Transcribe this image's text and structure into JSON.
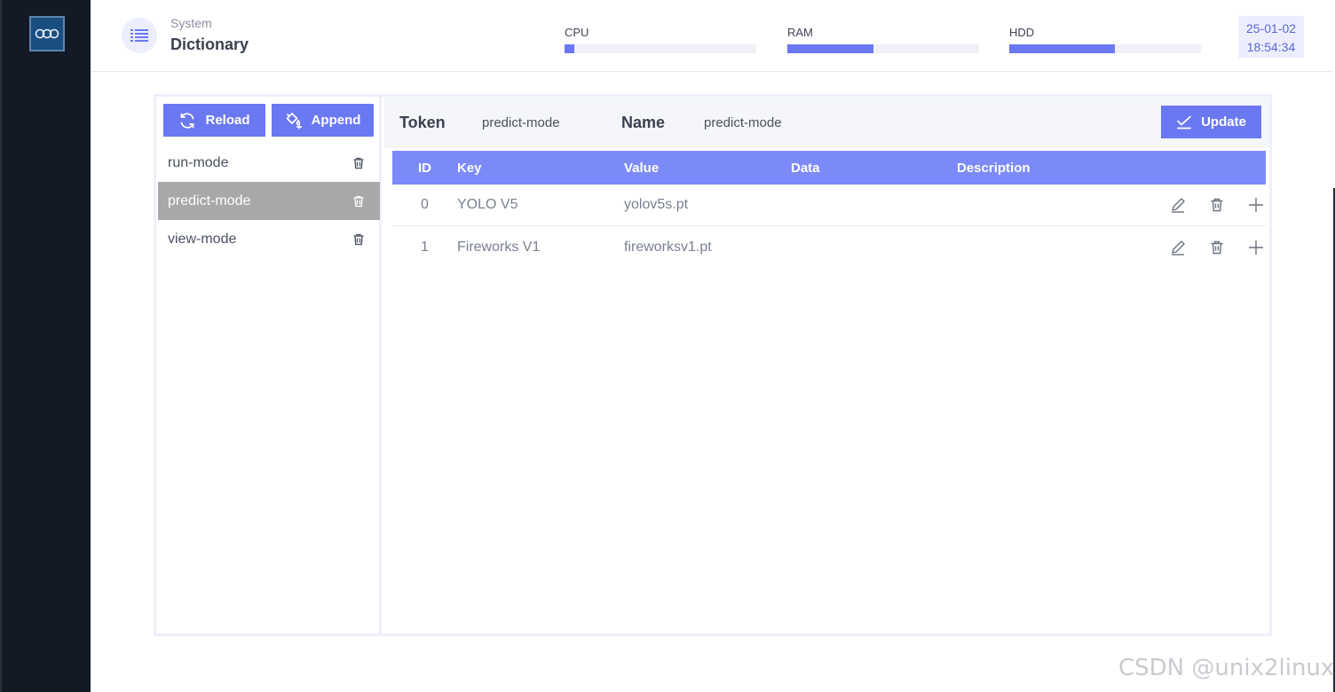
{
  "header": {
    "breadcrumb_parent": "System",
    "title": "Dictionary",
    "meters": [
      {
        "label": "CPU",
        "percent": 5
      },
      {
        "label": "RAM",
        "percent": 45
      },
      {
        "label": "HDD",
        "percent": 55
      }
    ],
    "clock": {
      "date": "25-01-02",
      "time": "18:54:34"
    }
  },
  "toolbar": {
    "reload_label": "Reload",
    "append_label": "Append"
  },
  "dictionaries": [
    {
      "name": "run-mode",
      "active": false
    },
    {
      "name": "predict-mode",
      "active": true
    },
    {
      "name": "view-mode",
      "active": false
    }
  ],
  "form": {
    "token_label": "Token",
    "token_value": "predict-mode",
    "name_label": "Name",
    "name_value": "predict-mode",
    "update_label": "Update"
  },
  "table": {
    "columns": [
      "ID",
      "Key",
      "Value",
      "Data",
      "Description"
    ],
    "rows": [
      {
        "id": "0",
        "key": "YOLO V5",
        "value": "yolov5s.pt",
        "data": "",
        "description": ""
      },
      {
        "id": "1",
        "key": "Fireworks V1",
        "value": "fireworksv1.pt",
        "data": "",
        "description": ""
      }
    ]
  },
  "watermark": "CSDN @unix2linux",
  "colors": {
    "accent": "#6a78f2",
    "table_header": "#7c8af9",
    "sidebar": "#131a25",
    "active_item": "#a8a8a8"
  }
}
